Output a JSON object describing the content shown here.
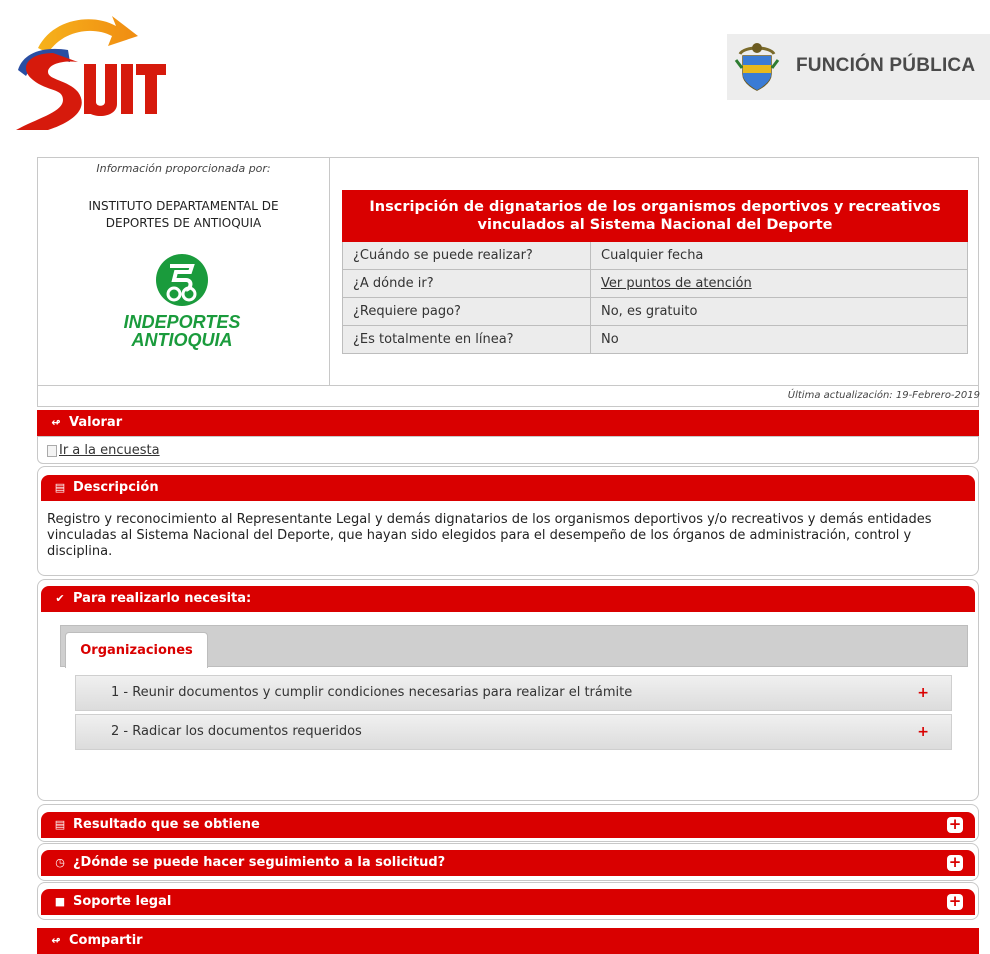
{
  "header": {
    "suit_logo_text": "SUIT",
    "funcion_publica_label": "FUNCIÓN PÚBLICA"
  },
  "info": {
    "provided_by_label": "Información proporcionada por:",
    "entity_line1": "INSTITUTO DEPARTAMENTAL DE",
    "entity_line2": "DEPORTES DE ANTIOQUIA",
    "entity_logo_line1": "INDEPORTES",
    "entity_logo_line2": "ANTIOQUIA"
  },
  "tramite": {
    "title_line1": "Inscripción de dignatarios de los organismos deportivos y recreativos",
    "title_line2": "vinculados al Sistema Nacional del Deporte",
    "rows": [
      {
        "question": "¿Cuándo se puede realizar?",
        "answer": "Cualquier fecha"
      },
      {
        "question": "¿A dónde ir?",
        "answer": "Ver puntos de atención"
      },
      {
        "question": "¿Requiere pago?",
        "answer": "No, es gratuito"
      },
      {
        "question": "¿Es totalmente en línea?",
        "answer": "No"
      }
    ]
  },
  "last_update": "Última actualización: 19-Febrero-2019",
  "sections": {
    "valorar": "Valorar",
    "survey_link": "Ir a la encuesta",
    "descripcion": "Descripción",
    "descripcion_text": "Registro y reconocimiento al Representante Legal y demás dignatarios de los organismos deportivos y/o recreativos y demás entidades vinculadas al Sistema Nacional del Deporte, que hayan sido elegidos para el desempeño de los órganos de administración, control y disciplina.",
    "para_realizarlo": "Para realizarlo necesita:",
    "resultado": "Resultado que se obtiene",
    "seguimiento": "¿Dónde se puede hacer seguimiento a la solicitud?",
    "soporte_legal": "Soporte legal",
    "compartir": "Compartir"
  },
  "tabs": [
    {
      "label": "Organizaciones",
      "active": true
    }
  ],
  "steps": [
    {
      "label": "1 - Reunir documentos y cumplir condiciones necesarias para realizar el trámite"
    },
    {
      "label": "2 - Radicar los documentos requeridos"
    }
  ],
  "colors": {
    "brand_red": "#d90000",
    "indeportes_green": "#1a9b3c"
  }
}
